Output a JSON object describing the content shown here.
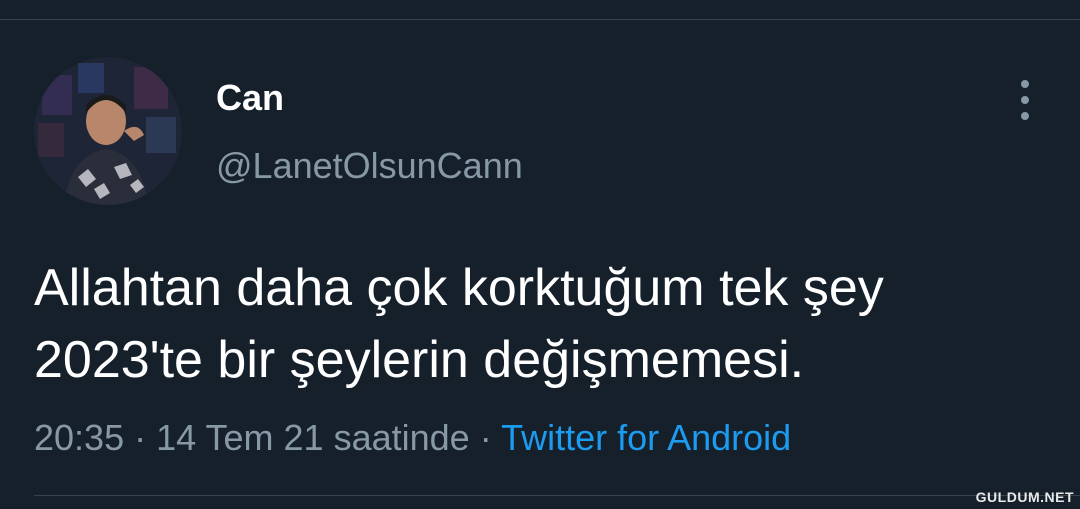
{
  "tweet": {
    "display_name": "Can",
    "handle": "@LanetOlsunCann",
    "text_lines": [
      "Allahtan daha çok korktuğum tek şey",
      "2023'te bir şeylerin değişmemesi."
    ],
    "time": "20:35",
    "separator": "·",
    "date_suffix": "14 Tem 21 saatinde",
    "source": "Twitter for Android"
  },
  "icons": {
    "more": "vertical-ellipsis-icon",
    "avatar": "profile-photo"
  },
  "watermark": "GULDUM.NET",
  "colors": {
    "background": "#15202b",
    "text_primary": "#ffffff",
    "text_secondary": "#8899a6",
    "link": "#1d9bf0",
    "divider": "#38444d"
  }
}
